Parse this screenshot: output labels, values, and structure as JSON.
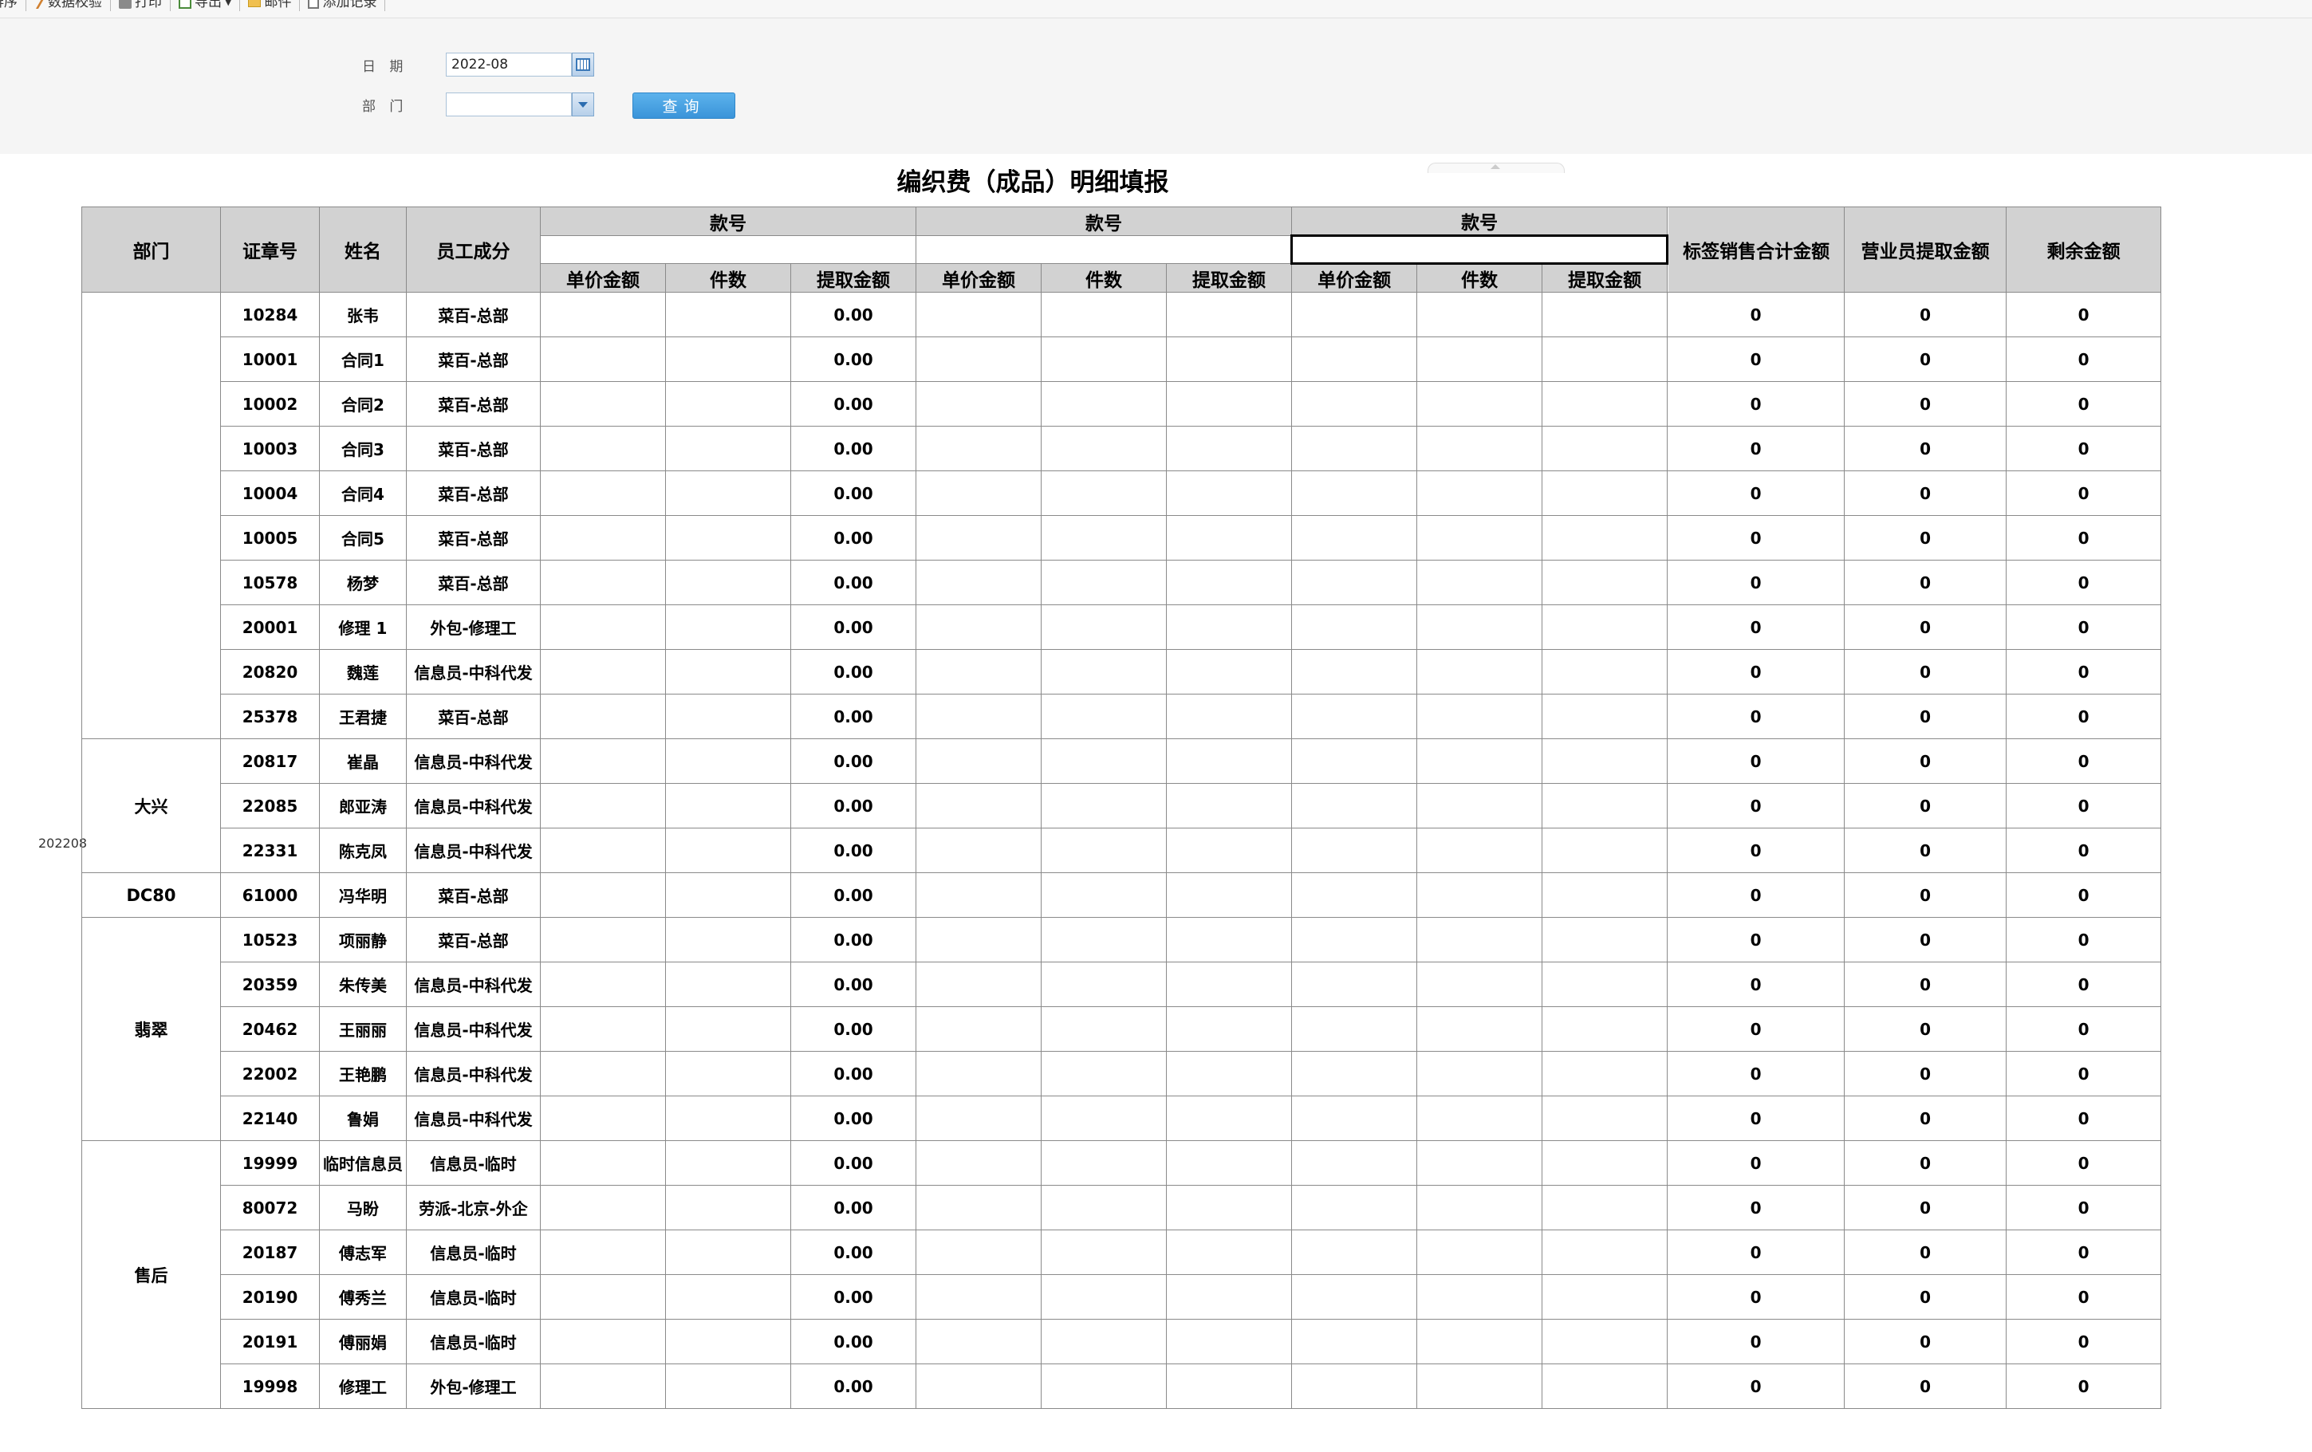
{
  "toolbar": {
    "items": [
      {
        "label": "排序",
        "icon": "sort-icon"
      },
      {
        "label": "数据校验",
        "icon": "wand-icon"
      },
      {
        "label": "打印",
        "icon": "printer-icon"
      },
      {
        "label": "导出",
        "icon": "export-icon"
      },
      {
        "label": "邮件",
        "icon": "mail-icon"
      },
      {
        "label": "添加记录",
        "icon": "add-record-icon"
      }
    ]
  },
  "filter": {
    "date_label": "日 期",
    "date_value": "2022-08",
    "dept_label": "部 门",
    "dept_value": "",
    "query_label": "查询"
  },
  "report": {
    "title": "编织费（成品）明细填报",
    "side_label": "202208",
    "headers": {
      "dept": "部门",
      "badge": "证章号",
      "name": "姓名",
      "member": "员工成分",
      "style_groups": [
        "款号",
        "款号",
        "款号"
      ],
      "sub": [
        "单价金额",
        "件数",
        "提取金额"
      ],
      "label_total": "标签销售合计金额",
      "sales_extract": "营业员提取金额",
      "remaining": "剩余金额"
    },
    "groups": [
      {
        "dept": "",
        "rows": [
          {
            "id": "10284",
            "name": "张韦",
            "type": "菜百-总部",
            "extract": "0.00",
            "total": "0",
            "sales": "0",
            "remain": "0"
          },
          {
            "id": "10001",
            "name": "合同1",
            "type": "菜百-总部",
            "extract": "0.00",
            "total": "0",
            "sales": "0",
            "remain": "0"
          },
          {
            "id": "10002",
            "name": "合同2",
            "type": "菜百-总部",
            "extract": "0.00",
            "total": "0",
            "sales": "0",
            "remain": "0"
          },
          {
            "id": "10003",
            "name": "合同3",
            "type": "菜百-总部",
            "extract": "0.00",
            "total": "0",
            "sales": "0",
            "remain": "0"
          },
          {
            "id": "10004",
            "name": "合同4",
            "type": "菜百-总部",
            "extract": "0.00",
            "total": "0",
            "sales": "0",
            "remain": "0"
          },
          {
            "id": "10005",
            "name": "合同5",
            "type": "菜百-总部",
            "extract": "0.00",
            "total": "0",
            "sales": "0",
            "remain": "0"
          },
          {
            "id": "10578",
            "name": "杨梦",
            "type": "菜百-总部",
            "extract": "0.00",
            "total": "0",
            "sales": "0",
            "remain": "0"
          },
          {
            "id": "20001",
            "name": "修理 1",
            "type": "外包-修理工",
            "extract": "0.00",
            "total": "0",
            "sales": "0",
            "remain": "0"
          },
          {
            "id": "20820",
            "name": "魏莲",
            "type": "信息员-中科代发",
            "extract": "0.00",
            "total": "0",
            "sales": "0",
            "remain": "0"
          },
          {
            "id": "25378",
            "name": "王君捷",
            "type": "菜百-总部",
            "extract": "0.00",
            "total": "0",
            "sales": "0",
            "remain": "0"
          }
        ]
      },
      {
        "dept": "大兴",
        "rows": [
          {
            "id": "20817",
            "name": "崔晶",
            "type": "信息员-中科代发",
            "extract": "0.00",
            "total": "0",
            "sales": "0",
            "remain": "0"
          },
          {
            "id": "22085",
            "name": "郎亚涛",
            "type": "信息员-中科代发",
            "extract": "0.00",
            "total": "0",
            "sales": "0",
            "remain": "0"
          },
          {
            "id": "22331",
            "name": "陈克凤",
            "type": "信息员-中科代发",
            "extract": "0.00",
            "total": "0",
            "sales": "0",
            "remain": "0"
          }
        ]
      },
      {
        "dept": "DC80",
        "rows": [
          {
            "id": "61000",
            "name": "冯华明",
            "type": "菜百-总部",
            "extract": "0.00",
            "total": "0",
            "sales": "0",
            "remain": "0"
          }
        ]
      },
      {
        "dept": "翡翠",
        "rows": [
          {
            "id": "10523",
            "name": "项丽静",
            "type": "菜百-总部",
            "extract": "0.00",
            "total": "0",
            "sales": "0",
            "remain": "0"
          },
          {
            "id": "20359",
            "name": "朱传美",
            "type": "信息员-中科代发",
            "extract": "0.00",
            "total": "0",
            "sales": "0",
            "remain": "0"
          },
          {
            "id": "20462",
            "name": "王丽丽",
            "type": "信息员-中科代发",
            "extract": "0.00",
            "total": "0",
            "sales": "0",
            "remain": "0"
          },
          {
            "id": "22002",
            "name": "王艳鹏",
            "type": "信息员-中科代发",
            "extract": "0.00",
            "total": "0",
            "sales": "0",
            "remain": "0"
          },
          {
            "id": "22140",
            "name": "鲁娟",
            "type": "信息员-中科代发",
            "extract": "0.00",
            "total": "0",
            "sales": "0",
            "remain": "0"
          }
        ]
      },
      {
        "dept": "售后",
        "rows": [
          {
            "id": "19999",
            "name": "临时信息员",
            "type": "信息员-临时",
            "extract": "0.00",
            "total": "0",
            "sales": "0",
            "remain": "0"
          },
          {
            "id": "80072",
            "name": "马盼",
            "type": "劳派-北京-外企",
            "extract": "0.00",
            "total": "0",
            "sales": "0",
            "remain": "0"
          },
          {
            "id": "20187",
            "name": "傅志军",
            "type": "信息员-临时",
            "extract": "0.00",
            "total": "0",
            "sales": "0",
            "remain": "0"
          },
          {
            "id": "20190",
            "name": "傅秀兰",
            "type": "信息员-临时",
            "extract": "0.00",
            "total": "0",
            "sales": "0",
            "remain": "0"
          },
          {
            "id": "20191",
            "name": "傅丽娟",
            "type": "信息员-临时",
            "extract": "0.00",
            "total": "0",
            "sales": "0",
            "remain": "0"
          },
          {
            "id": "19998",
            "name": "修理工",
            "type": "外包-修理工",
            "extract": "0.00",
            "total": "0",
            "sales": "0",
            "remain": "0"
          }
        ]
      }
    ]
  }
}
